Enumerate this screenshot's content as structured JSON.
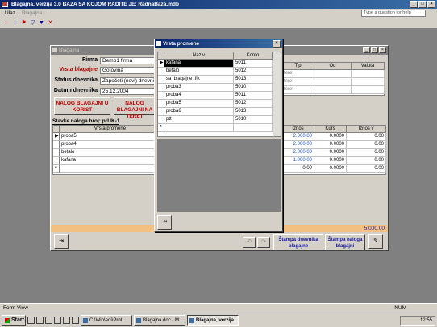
{
  "app": {
    "title": "Blagajna, verzija 3.0    BAZA SA KOJOM RADITE JE: RadnaBaza.mdb",
    "menu": [
      "Ulaz",
      "Blagajna"
    ],
    "help_placeholder": "Type a question for help"
  },
  "form": {
    "title": "Blagajna",
    "labels": {
      "firma": "Firma",
      "vrsta": "Vrsta blagajne",
      "status": "Status dnevnika",
      "datum": "Datum dnevnika"
    },
    "values": {
      "firma": "Demo1 firma",
      "vrsta": "Gotovina",
      "status": "Započeti (novi) dnevnik",
      "datum": "25.12.2004"
    },
    "btn_korist": "NALOG BLAGAJNI U KORIST",
    "btn_teret": "NALOG BLAGAJNI NA TERET",
    "top_table": {
      "headers": [
        "Tip",
        "Od",
        "Valuta"
      ],
      "rows": [
        [
          "teret",
          "",
          ""
        ],
        [
          "teret",
          "",
          ""
        ],
        [
          "teret",
          "",
          ""
        ]
      ]
    },
    "stavke_title": "Stavke naloga broj: prUK-1",
    "stavke": {
      "headers": [
        "Vrsta promene",
        "Iznos",
        "Kurs",
        "Iznos v"
      ],
      "rows": [
        [
          "proba5",
          "2.000,00",
          "0.0000",
          "0.00"
        ],
        [
          "proba4",
          "2.000,00",
          "0.0000",
          "0.00"
        ],
        [
          "betalo",
          "2.000,00",
          "0.0000",
          "0.00"
        ],
        [
          "kafana",
          "1.000,00",
          "0.0000",
          "0.00"
        ],
        [
          "",
          "0.00",
          "0.0000",
          "0.00"
        ]
      ]
    },
    "total": "5.000,00",
    "btn_stampa_dnevnika": "Štampa dnevnika blagajne",
    "btn_stampa_naloga": "Štampa naloga blagajni"
  },
  "popup": {
    "title": "Vrsta promene",
    "headers": [
      "Naziv",
      "Konto"
    ],
    "rows": [
      [
        "kafana",
        "5011"
      ],
      [
        "betalo",
        "5012"
      ],
      [
        "sa_blagajne_fik",
        "5013"
      ],
      [
        "proba3",
        "5010"
      ],
      [
        "proba4",
        "5011"
      ],
      [
        "proba5",
        "5012"
      ],
      [
        "proba6",
        "5013"
      ],
      [
        "ptt",
        "5010"
      ]
    ]
  },
  "statusbar": {
    "left": "Form View",
    "right": "NUM"
  },
  "taskbar": {
    "start": "Start",
    "tasks": [
      "C:\\Win\\edi\\Prot...",
      "Blagajna.doc - M...",
      "Blagajna, verzija..."
    ],
    "clock": "12:55"
  }
}
